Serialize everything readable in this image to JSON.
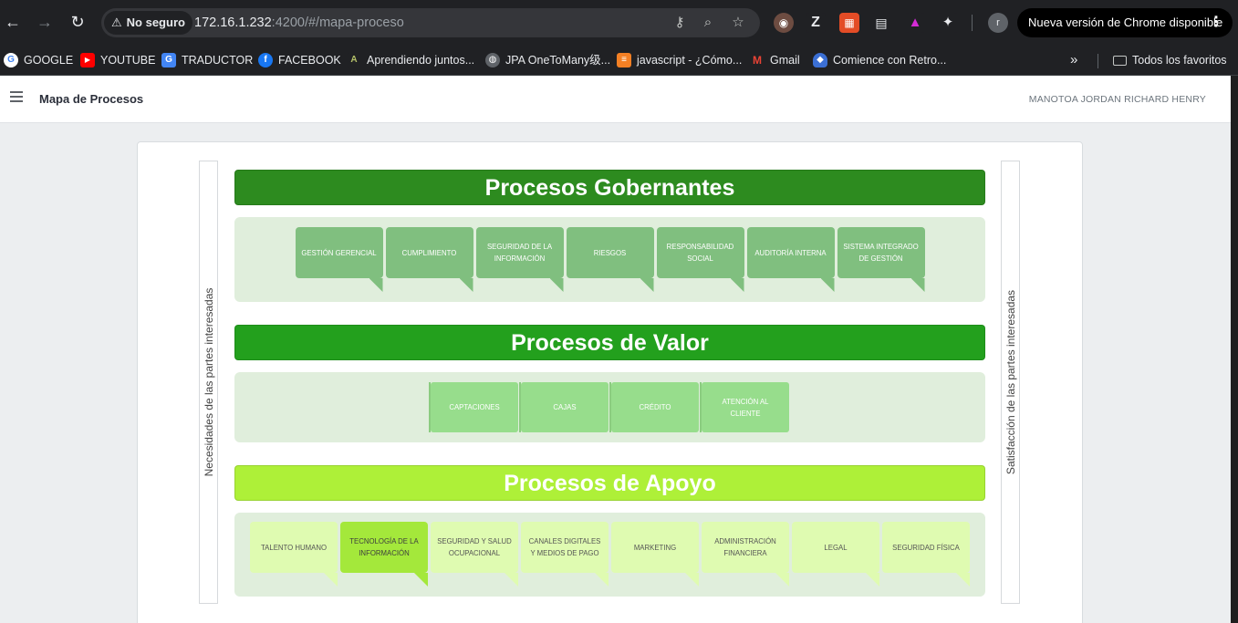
{
  "browser": {
    "security_label": "No seguro",
    "url_host": "172.16.1.232",
    "url_rest": ":4200/#/mapa-proceso",
    "profile_initial": "r",
    "update_label": "Nueva versión de Chrome disponible",
    "icons": [
      "back-icon",
      "forward-icon",
      "reload-icon",
      "warning-icon",
      "key-icon",
      "zoom-icon",
      "star-icon",
      "extensions-icon",
      "kebab-icon"
    ]
  },
  "bookmarks": {
    "items": [
      {
        "label": "GOOGLE",
        "icon": "G",
        "color": "#ffffff"
      },
      {
        "label": "YOUTUBE",
        "icon": "▶",
        "color": "#ff0000"
      },
      {
        "label": "TRADUCTOR",
        "icon": "G",
        "color": "#4285f4"
      },
      {
        "label": "FACEBOOK",
        "icon": "f",
        "color": "#1877f2"
      },
      {
        "label": "Aprendiendo juntos...",
        "icon": "A",
        "color": "#7c8c3a"
      },
      {
        "label": "JPA OneToMany级...",
        "icon": "◍",
        "color": "#5f6368"
      },
      {
        "label": "javascript - ¿Cómo...",
        "icon": "≡",
        "color": "#f48024"
      },
      {
        "label": "Gmail",
        "icon": "M",
        "color": "#ea4335"
      },
      {
        "label": "Comience con Retro...",
        "icon": "◆",
        "color": "#3b6fd4"
      }
    ],
    "more": "»",
    "all_favorites": "Todos los favoritos"
  },
  "header": {
    "title": "Mapa de Procesos",
    "user": "MANOTOA JORDAN RICHARD HENRY"
  },
  "map": {
    "left_label": "Necesidades de las partes interesadas",
    "right_label": "Satisfacción de las partes interesadas",
    "gobernantes": {
      "title": "Procesos Gobernantes",
      "items": [
        "GESTIÓN GERENCIAL",
        "CUMPLIMIENTO",
        "SEGURIDAD DE LA INFORMACIÓN",
        "RIESGOS",
        "RESPONSABILIDAD SOCIAL",
        "AUDITORÍA INTERNA",
        "SISTEMA INTEGRADO DE GESTIÓN"
      ]
    },
    "valor": {
      "title": "Procesos de Valor",
      "items": [
        "CAPTACIONES",
        "CAJAS",
        "CRÉDITO",
        "ATENCIÓN AL CLIENTE"
      ]
    },
    "apoyo": {
      "title": "Procesos de Apoyo",
      "items": [
        "TALENTO HUMANO",
        "TECNOLOGÍA DE LA INFORMACIÓN",
        "SEGURIDAD Y SALUD OCUPACIONAL",
        "CANALES DIGITALES Y MEDIOS DE PAGO",
        "MARKETING",
        "ADMINISTRACIÓN FINANCIERA",
        "LEGAL",
        "SEGURIDAD FÍSICA"
      ],
      "active_item": "TECNOLOGÍA DE LA INFORMACIÓN"
    }
  },
  "colors": {
    "gobernantes_banner": "#2d8b1f",
    "valor_banner": "#23a01d",
    "apoyo_banner": "#aef038",
    "gobernantes_tile": "#80bf7f",
    "valor_tile": "#97dd8c",
    "apoyo_tile": "#dffbb1",
    "apoyo_active_tile": "#a4e83b"
  }
}
